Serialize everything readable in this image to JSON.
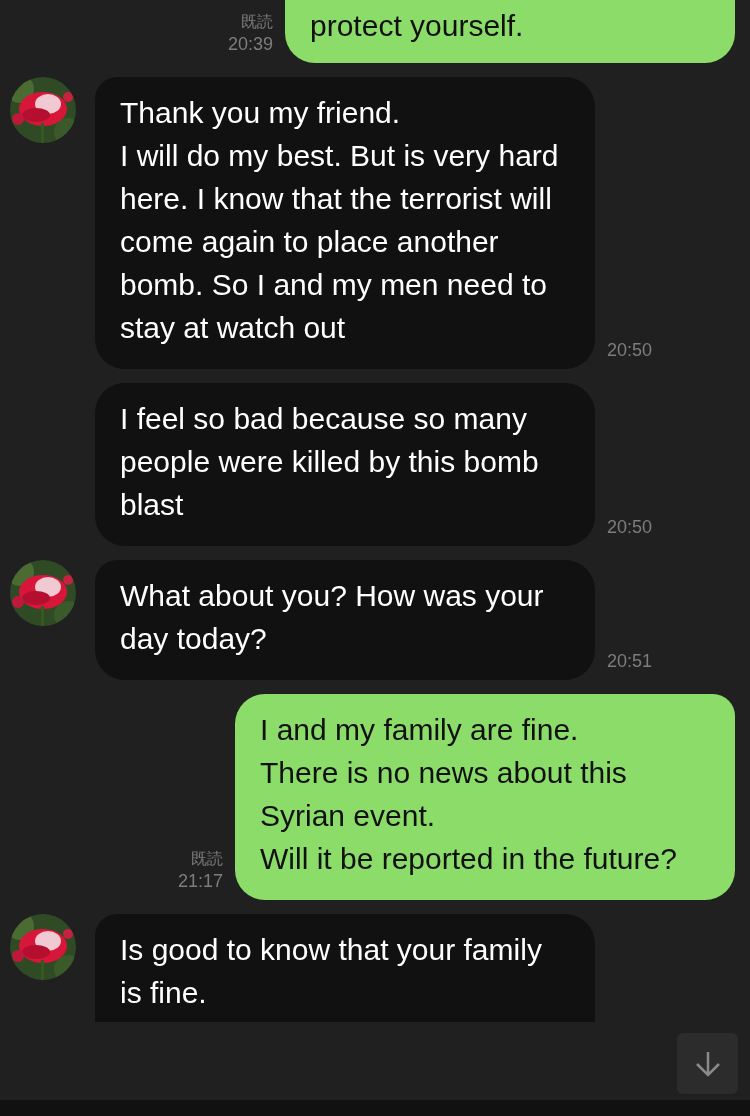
{
  "messages": [
    {
      "kind": "sent",
      "text": "protect yourself.",
      "read": "既読",
      "time": "20:39",
      "cut_top": true
    },
    {
      "kind": "received",
      "show_avatar": true,
      "text": "Thank you my friend.\nI will do my best. But is very hard here. I know that the terrorist will come again to place another bomb. So I and my men need to stay at watch out",
      "time": "20:50"
    },
    {
      "kind": "received",
      "show_avatar": false,
      "text": "I feel so bad because so many people were killed by this bomb blast",
      "time": "20:50"
    },
    {
      "kind": "received",
      "show_avatar": true,
      "text": "What about you? How was your day today?",
      "time": "20:51"
    },
    {
      "kind": "sent",
      "text": "I and my family are fine.\nThere is no news about this Syrian event.\nWill it be reported in the future?",
      "read": "既読",
      "time": "21:17"
    },
    {
      "kind": "received",
      "show_avatar": true,
      "text": "Is good to know that your family is fine.",
      "cut_bottom": true
    }
  ],
  "scroll_button": {
    "visible": true
  }
}
